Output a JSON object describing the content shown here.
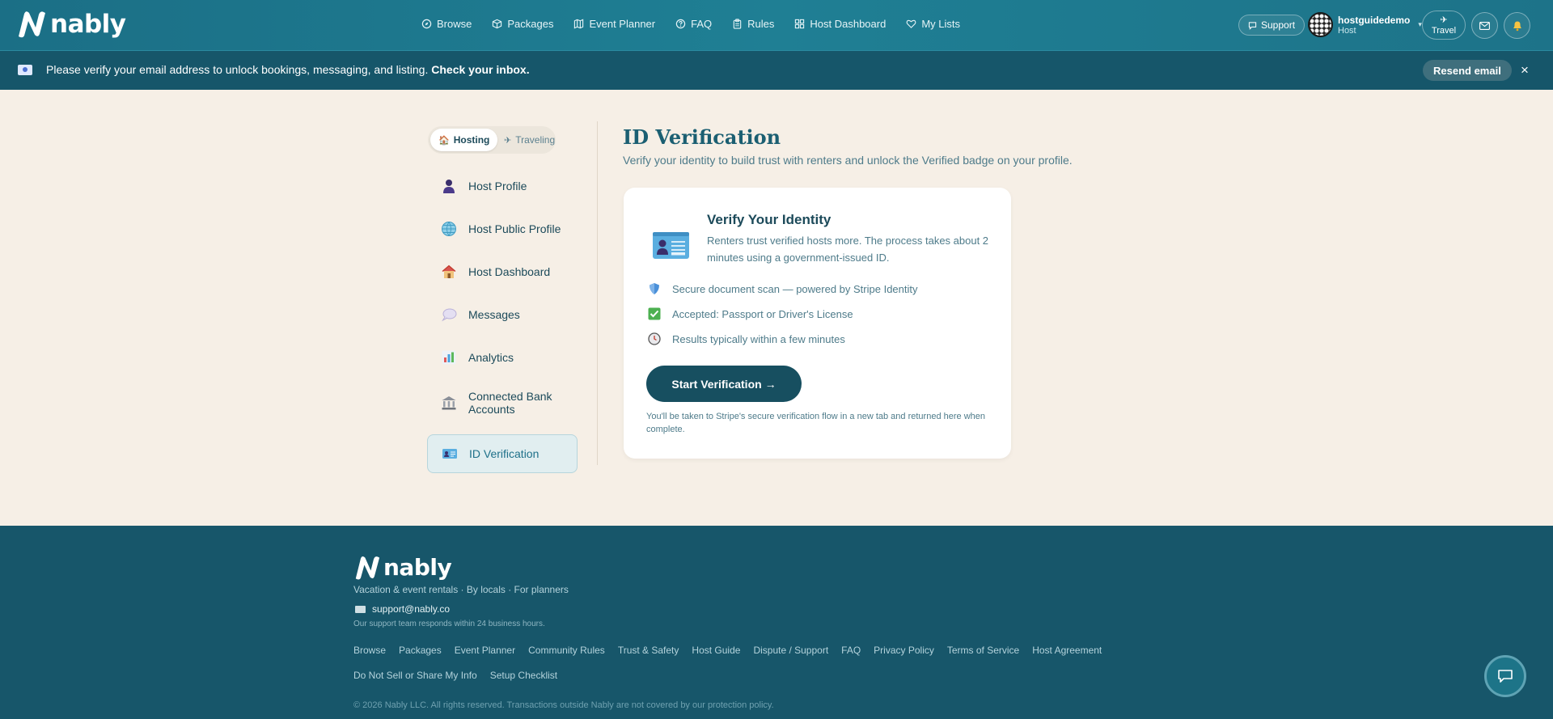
{
  "header": {
    "logo_text": "nably",
    "nav": [
      {
        "label": "Browse",
        "icon": "compass-icon"
      },
      {
        "label": "Packages",
        "icon": "package-icon"
      },
      {
        "label": "Event Planner",
        "icon": "map-icon"
      },
      {
        "label": "FAQ",
        "icon": "help-icon"
      },
      {
        "label": "Rules",
        "icon": "clipboard-icon"
      },
      {
        "label": "Host Dashboard",
        "icon": "grid-icon"
      },
      {
        "label": "My Lists",
        "icon": "heart-icon"
      }
    ],
    "support_label": "Support",
    "user_name": "hostguidedemo",
    "user_role": "Host",
    "travel_label": "Travel"
  },
  "banner": {
    "text": "Please verify your email address to unlock bookings, messaging, and listing.",
    "cta": "Check your inbox.",
    "resend_label": "Resend email",
    "close_symbol": "×"
  },
  "sidebar": {
    "toggle": {
      "hosting": "Hosting",
      "traveling": "Traveling"
    },
    "items": [
      {
        "label": "Host Profile",
        "icon": "person-icon"
      },
      {
        "label": "Host Public Profile",
        "icon": "globe-icon"
      },
      {
        "label": "Host Dashboard",
        "icon": "house-icon"
      },
      {
        "label": "Messages",
        "icon": "speech-bubble-icon"
      },
      {
        "label": "Analytics",
        "icon": "bar-chart-icon"
      },
      {
        "label": "Connected Bank Accounts",
        "icon": "bank-icon"
      },
      {
        "label": "ID Verification",
        "icon": "id-card-icon",
        "active": true
      }
    ]
  },
  "main": {
    "title": "ID Verification",
    "subtitle": "Verify your identity to build trust with renters and unlock the Verified badge on your profile.",
    "card": {
      "title": "Verify Your Identity",
      "description": "Renters trust verified hosts more. The process takes about 2 minutes using a government-issued ID.",
      "features": [
        {
          "text": "Secure document scan — powered by Stripe Identity",
          "icon": "shield-icon"
        },
        {
          "text": "Accepted: Passport or Driver's License",
          "icon": "check-box-icon"
        },
        {
          "text": "Results typically within a few minutes",
          "icon": "clock-icon"
        }
      ],
      "button_label": "Start Verification →",
      "note": "You'll be taken to Stripe's secure verification flow in a new tab and returned here when complete."
    }
  },
  "footer": {
    "logo_text": "nably",
    "tagline": "Vacation & event rentals · By locals · For planners",
    "email": "support@nably.co",
    "response": "Our support team responds within 24 business hours.",
    "links_row1": [
      "Browse",
      "Packages",
      "Event Planner",
      "Community Rules",
      "Trust & Safety",
      "Host Guide",
      "Dispute / Support",
      "FAQ",
      "Privacy Policy",
      "Terms of Service",
      "Host Agreement"
    ],
    "links_row2": [
      "Do Not Sell or Share My Info",
      "Setup Checklist"
    ],
    "copyright": "© 2026 Nably LLC. All rights reserved. Transactions outside Nably are not covered by our protection policy."
  },
  "colors": {
    "header_bg": "#1f7f94",
    "banner_bg": "#16566a",
    "page_bg": "#f6efe6",
    "primary_button": "#174f60",
    "footer_bg": "#17566a"
  }
}
